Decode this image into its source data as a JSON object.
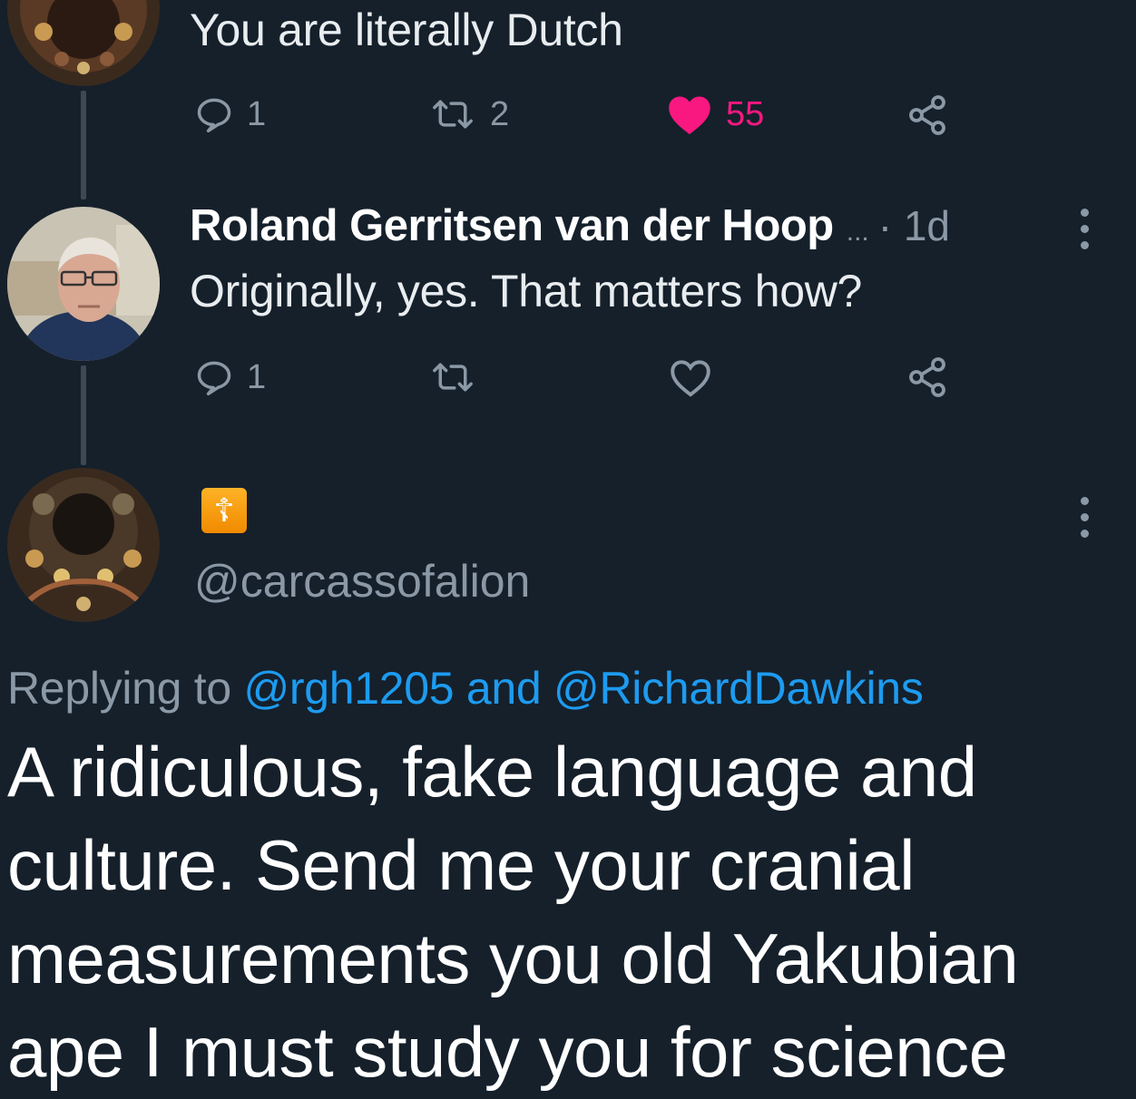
{
  "tweet1": {
    "text": "You are literally Dutch",
    "reply_count": "1",
    "retweet_count": "2",
    "like_count": "55"
  },
  "tweet2": {
    "display_name": "Roland Gerritsen van der Hoop",
    "ellipsis": "...",
    "time": "· 1d",
    "text": "Originally, yes. That matters how?",
    "reply_count": "1"
  },
  "tweet3": {
    "name_emoji": "☦",
    "handle": "@carcassofalion",
    "replying_prefix": "Replying to",
    "mention_1": "@rgh1205",
    "and_word": "and",
    "mention_2": "@RichardDawkins",
    "lines": [
      "A ridiculous, fake language and",
      "culture. Send me your cranial",
      "measurements you old Yakubian",
      "ape I must study you for science"
    ]
  },
  "colors": {
    "background": "#15202b",
    "muted": "#8b98a5",
    "like": "#f91880",
    "link": "#1d9bf0"
  }
}
